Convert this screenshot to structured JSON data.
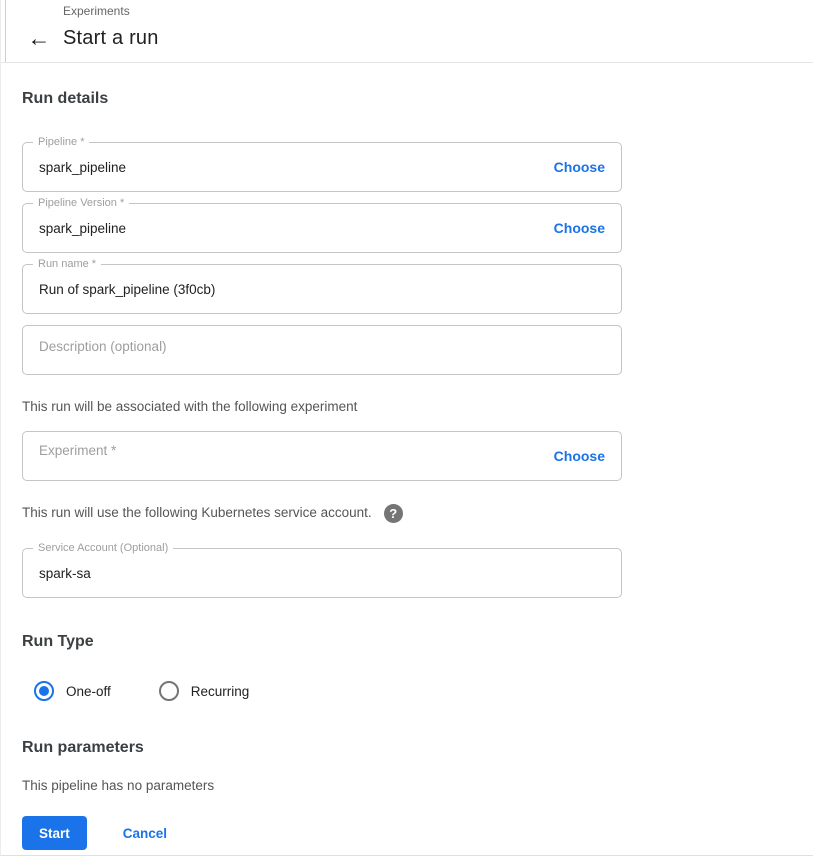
{
  "header": {
    "breadcrumb": "Experiments",
    "title": "Start a run",
    "back_icon": "←"
  },
  "sections": {
    "run_details": "Run details",
    "run_type": "Run Type",
    "run_parameters": "Run parameters"
  },
  "fields": {
    "pipeline": {
      "label": "Pipeline *",
      "value": "spark_pipeline",
      "action": "Choose"
    },
    "pipeline_version": {
      "label": "Pipeline Version *",
      "value": "spark_pipeline",
      "action": "Choose"
    },
    "run_name": {
      "label": "Run name *",
      "value": "Run of spark_pipeline (3f0cb)"
    },
    "description": {
      "placeholder": "Description (optional)",
      "value": ""
    },
    "experiment": {
      "placeholder": "Experiment *",
      "value": "",
      "action": "Choose"
    },
    "service_account": {
      "label": "Service Account (Optional)",
      "value": "spark-sa"
    }
  },
  "notes": {
    "experiment": "This run will be associated with the following experiment",
    "service_account": "This run will use the following Kubernetes service account.",
    "help_glyph": "?"
  },
  "run_type": {
    "options": [
      {
        "label": "One-off",
        "selected": true
      },
      {
        "label": "Recurring",
        "selected": false
      }
    ]
  },
  "run_parameters": {
    "empty_message": "This pipeline has no parameters"
  },
  "actions": {
    "start": "Start",
    "cancel": "Cancel"
  },
  "colors": {
    "accent": "#1a73e8",
    "heading": "#3c4043",
    "body_text": "#555555",
    "field_border": "#c4c4c4",
    "field_label": "#9e9e9e",
    "help_icon_bg": "#757575"
  }
}
